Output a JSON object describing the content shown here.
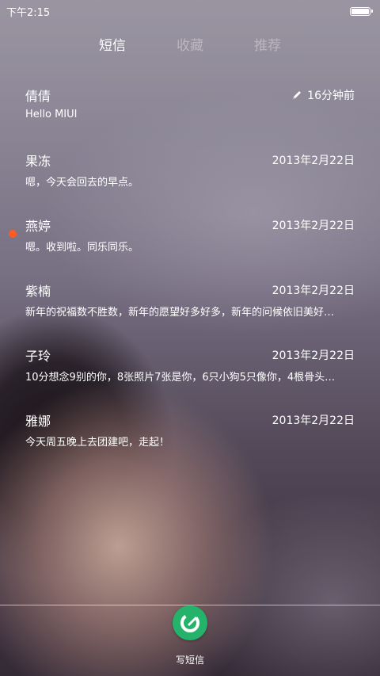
{
  "status_bar": {
    "time": "下午2:15"
  },
  "tabs": [
    {
      "label": "短信",
      "active": true
    },
    {
      "label": "收藏",
      "active": false
    },
    {
      "label": "推荐",
      "active": false
    }
  ],
  "messages": [
    {
      "name": "倩倩",
      "preview": "Hello MIUI",
      "date": "16分钟前",
      "draft_icon": "pencil-icon",
      "unread": false
    },
    {
      "name": "果冻",
      "preview": "嗯，今天会回去的早点。",
      "date": "2013年2月22日",
      "unread": false
    },
    {
      "name": "燕婷",
      "preview": "嗯。收到啦。同乐同乐。",
      "date": "2013年2月22日",
      "unread": true
    },
    {
      "name": "紫楠",
      "preview": "新年的祝福数不胜数，新年的愿望好多好多，新年的问候依旧美好…",
      "date": "2013年2月22日",
      "unread": false
    },
    {
      "name": "子玲",
      "preview": "10分想念9别的你，8张照片7张是你，6只小狗5只像你，4根骨头…",
      "date": "2013年2月22日",
      "unread": false
    },
    {
      "name": "雅娜",
      "preview": "今天周五晚上去团建吧，走起！",
      "date": "2013年2月22日",
      "unread": false
    }
  ],
  "compose": {
    "label": "写短信",
    "icon": "compose-icon"
  },
  "colors": {
    "accent_green": "#25b36b",
    "unread_dot": "#ff5a1f"
  }
}
